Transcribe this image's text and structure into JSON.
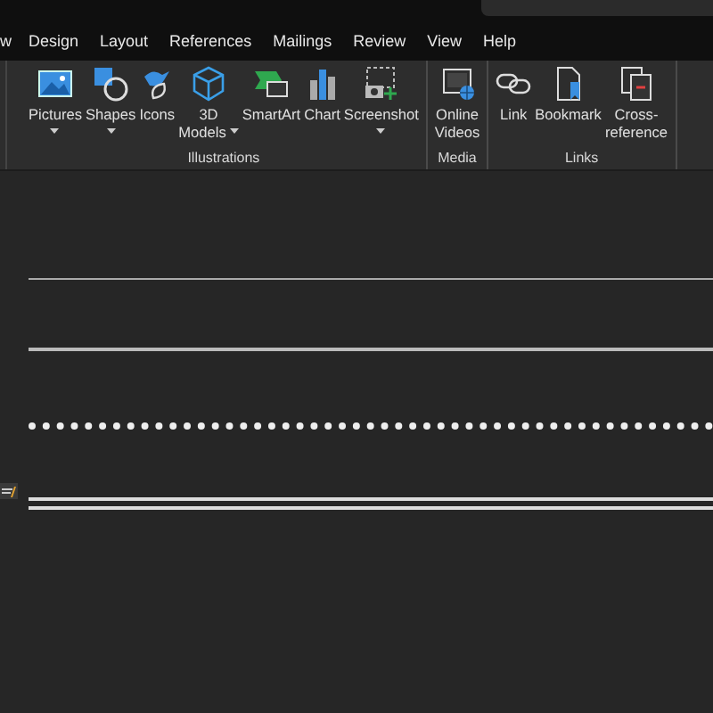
{
  "tabs": [
    {
      "label": "w",
      "selected": false
    },
    {
      "label": "Design",
      "selected": false
    },
    {
      "label": "Layout",
      "selected": false
    },
    {
      "label": "References",
      "selected": false
    },
    {
      "label": "Mailings",
      "selected": false
    },
    {
      "label": "Review",
      "selected": false
    },
    {
      "label": "View",
      "selected": false
    },
    {
      "label": "Help",
      "selected": false
    }
  ],
  "ribbon_groups": [
    {
      "name": "Illustrations",
      "commands": [
        {
          "kind": "picture",
          "lines": [
            "Pictures"
          ],
          "dropdown": true
        },
        {
          "kind": "shapes",
          "lines": [
            "Shapes"
          ],
          "dropdown": true
        },
        {
          "kind": "icons",
          "lines": [
            "Icons"
          ],
          "dropdown": false
        },
        {
          "kind": "cube",
          "lines": [
            "3D",
            "Models"
          ],
          "dropdown": true
        },
        {
          "kind": "smartart",
          "lines": [
            "SmartArt"
          ],
          "dropdown": false
        },
        {
          "kind": "chart",
          "lines": [
            "Chart"
          ],
          "dropdown": false
        },
        {
          "kind": "screenshot",
          "lines": [
            "Screenshot"
          ],
          "dropdown": true
        }
      ]
    },
    {
      "name": "Media",
      "commands": [
        {
          "kind": "video",
          "lines": [
            "Online",
            "Videos"
          ],
          "dropdown": false
        }
      ]
    },
    {
      "name": "Links",
      "commands": [
        {
          "kind": "link",
          "lines": [
            "Link"
          ],
          "dropdown": false
        },
        {
          "kind": "bookmark",
          "lines": [
            "Bookmark"
          ],
          "dropdown": false
        },
        {
          "kind": "crossref",
          "lines": [
            "Cross-",
            "reference"
          ],
          "dropdown": false
        }
      ]
    }
  ],
  "document_rules": [
    {
      "kind": "thin"
    },
    {
      "kind": "thick"
    },
    {
      "kind": "dotted"
    },
    {
      "kind": "double"
    }
  ]
}
